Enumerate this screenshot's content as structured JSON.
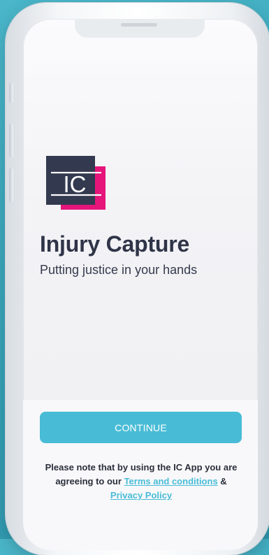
{
  "app": {
    "title": "Injury Capture",
    "tagline": "Putting justice in your hands",
    "logo": {
      "text": "IC",
      "colors": {
        "dark": "#333a4f",
        "accent": "#e5157a"
      }
    }
  },
  "actions": {
    "continue_label": "CONTINUE",
    "continue_color": "#48bcd6"
  },
  "legal": {
    "notice": "Please note that by using the IC App you are agreeing to our",
    "terms_label": "Terms and conditions",
    "separator": "&",
    "privacy_label": "Privacy Policy"
  }
}
